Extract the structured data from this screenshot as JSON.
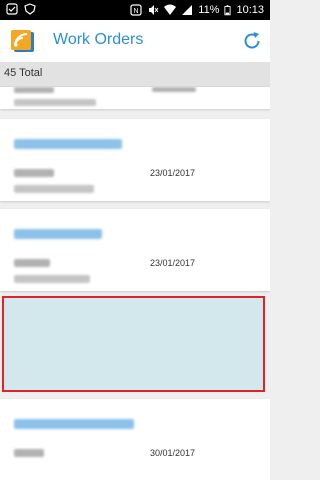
{
  "status_bar": {
    "battery_percent": "11%",
    "time": "10:13",
    "icons": [
      "notification-icon",
      "shield-icon",
      "nfc-icon",
      "mute-icon",
      "wifi-icon",
      "signal-icon",
      "battery-icon"
    ]
  },
  "header": {
    "title": "Work Orders",
    "logo": "work-orders-logo",
    "refresh_icon": "refresh-icon"
  },
  "summary": {
    "total_label": "45 Total"
  },
  "work_orders": [
    {
      "date": "23/01/2017",
      "title_redacted": true
    },
    {
      "date": "23/01/2017",
      "title_redacted": true
    },
    {
      "date": "23/01/2017",
      "title_redacted": true
    },
    {
      "date": "",
      "selected": true
    },
    {
      "date": "30/01/2017",
      "title_redacted": true
    }
  ],
  "colors": {
    "accent": "#2b8fd8",
    "selection_fill": "#d3e8ec",
    "selection_border": "#e0222b",
    "status_bar": "#000000",
    "list_background": "#efefef"
  }
}
